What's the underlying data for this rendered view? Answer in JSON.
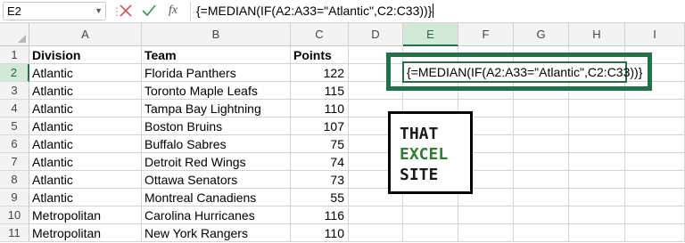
{
  "name_box": "E2",
  "formula_bar": {
    "fx_label": "fx",
    "formula": "{=MEDIAN(IF(A2:A33=\"Atlantic\",C2:C33))}"
  },
  "columns": [
    "A",
    "B",
    "C",
    "D",
    "E",
    "F",
    "G",
    "H",
    "I"
  ],
  "rows": [
    "1",
    "2",
    "3",
    "4",
    "5",
    "6",
    "7",
    "8",
    "9",
    "10",
    "11"
  ],
  "table": {
    "headers": [
      "Division",
      "Team",
      "Points"
    ],
    "rows": [
      [
        "Atlantic",
        "Florida Panthers",
        "122"
      ],
      [
        "Atlantic",
        "Toronto Maple Leafs",
        "115"
      ],
      [
        "Atlantic",
        "Tampa Bay Lightning",
        "110"
      ],
      [
        "Atlantic",
        "Boston Bruins",
        "107"
      ],
      [
        "Atlantic",
        "Buffalo Sabres",
        "75"
      ],
      [
        "Atlantic",
        "Detroit Red Wings",
        "74"
      ],
      [
        "Atlantic",
        "Ottawa Senators",
        "73"
      ],
      [
        "Atlantic",
        "Montreal Canadiens",
        "55"
      ],
      [
        "Metropolitan",
        "Carolina Hurricanes",
        "116"
      ],
      [
        "Metropolitan",
        "New York Rangers",
        "110"
      ]
    ]
  },
  "active_cell_display": "{=MEDIAN(IF(A2:A33=\"Atlantic\",C2:C33))}",
  "logo": {
    "line1": "THAT",
    "line2": "EXCEL",
    "line3": "SITE"
  },
  "colors": {
    "accent": "#217346",
    "logo_green": "#2e7d32",
    "cancel_red": "#d9534f",
    "enter_green": "#2e9b4a"
  },
  "icons": {
    "cancel": "close-icon",
    "enter": "checkmark-icon",
    "name_box_dropdown": "chevron-down-icon"
  }
}
